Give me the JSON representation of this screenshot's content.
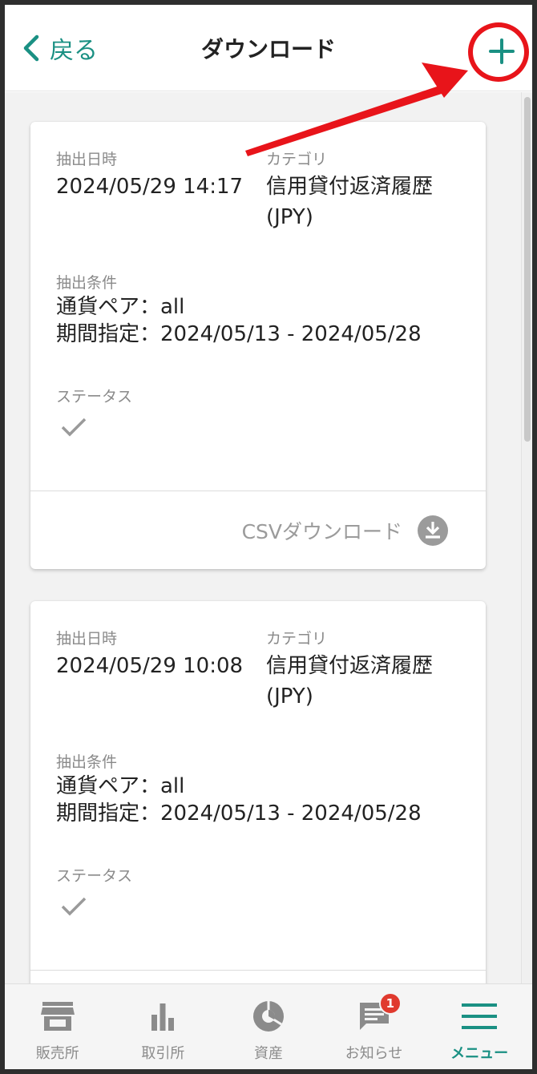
{
  "header": {
    "back_label": "戻る",
    "title": "ダウンロード",
    "back_icon": "chevron-left-icon",
    "add_icon": "plus-icon"
  },
  "labels": {
    "extracted_at": "抽出日時",
    "category": "カテゴリ",
    "conditions": "抽出条件",
    "status": "ステータス",
    "csv_download": "CSVダウンロード"
  },
  "records": [
    {
      "extracted_at": "2024/05/29 14:17",
      "category_line1": "信用貸付返済履歴",
      "category_line2": "(JPY)",
      "condition_pair": "通貨ペア：all",
      "condition_period": "期間指定：2024/05/13 - 2024/05/28",
      "status_icon": "check-icon"
    },
    {
      "extracted_at": "2024/05/29 10:08",
      "category_line1": "信用貸付返済履歴",
      "category_line2": "(JPY)",
      "condition_pair": "通貨ペア：all",
      "condition_period": "期間指定：2024/05/13 - 2024/05/28",
      "status_icon": "check-icon"
    }
  ],
  "bottom_nav": [
    {
      "label": "販売所",
      "icon": "shop-icon"
    },
    {
      "label": "取引所",
      "icon": "bar-chart-icon"
    },
    {
      "label": "資産",
      "icon": "pie-chart-icon"
    },
    {
      "label": "お知らせ",
      "icon": "message-icon",
      "badge": "1"
    },
    {
      "label": "メニュー",
      "icon": "menu-icon",
      "active": true
    }
  ],
  "colors": {
    "accent": "#1a9083",
    "annotation": "#e8141a",
    "badge": "#e03a2e",
    "muted": "#8a8a8a"
  }
}
